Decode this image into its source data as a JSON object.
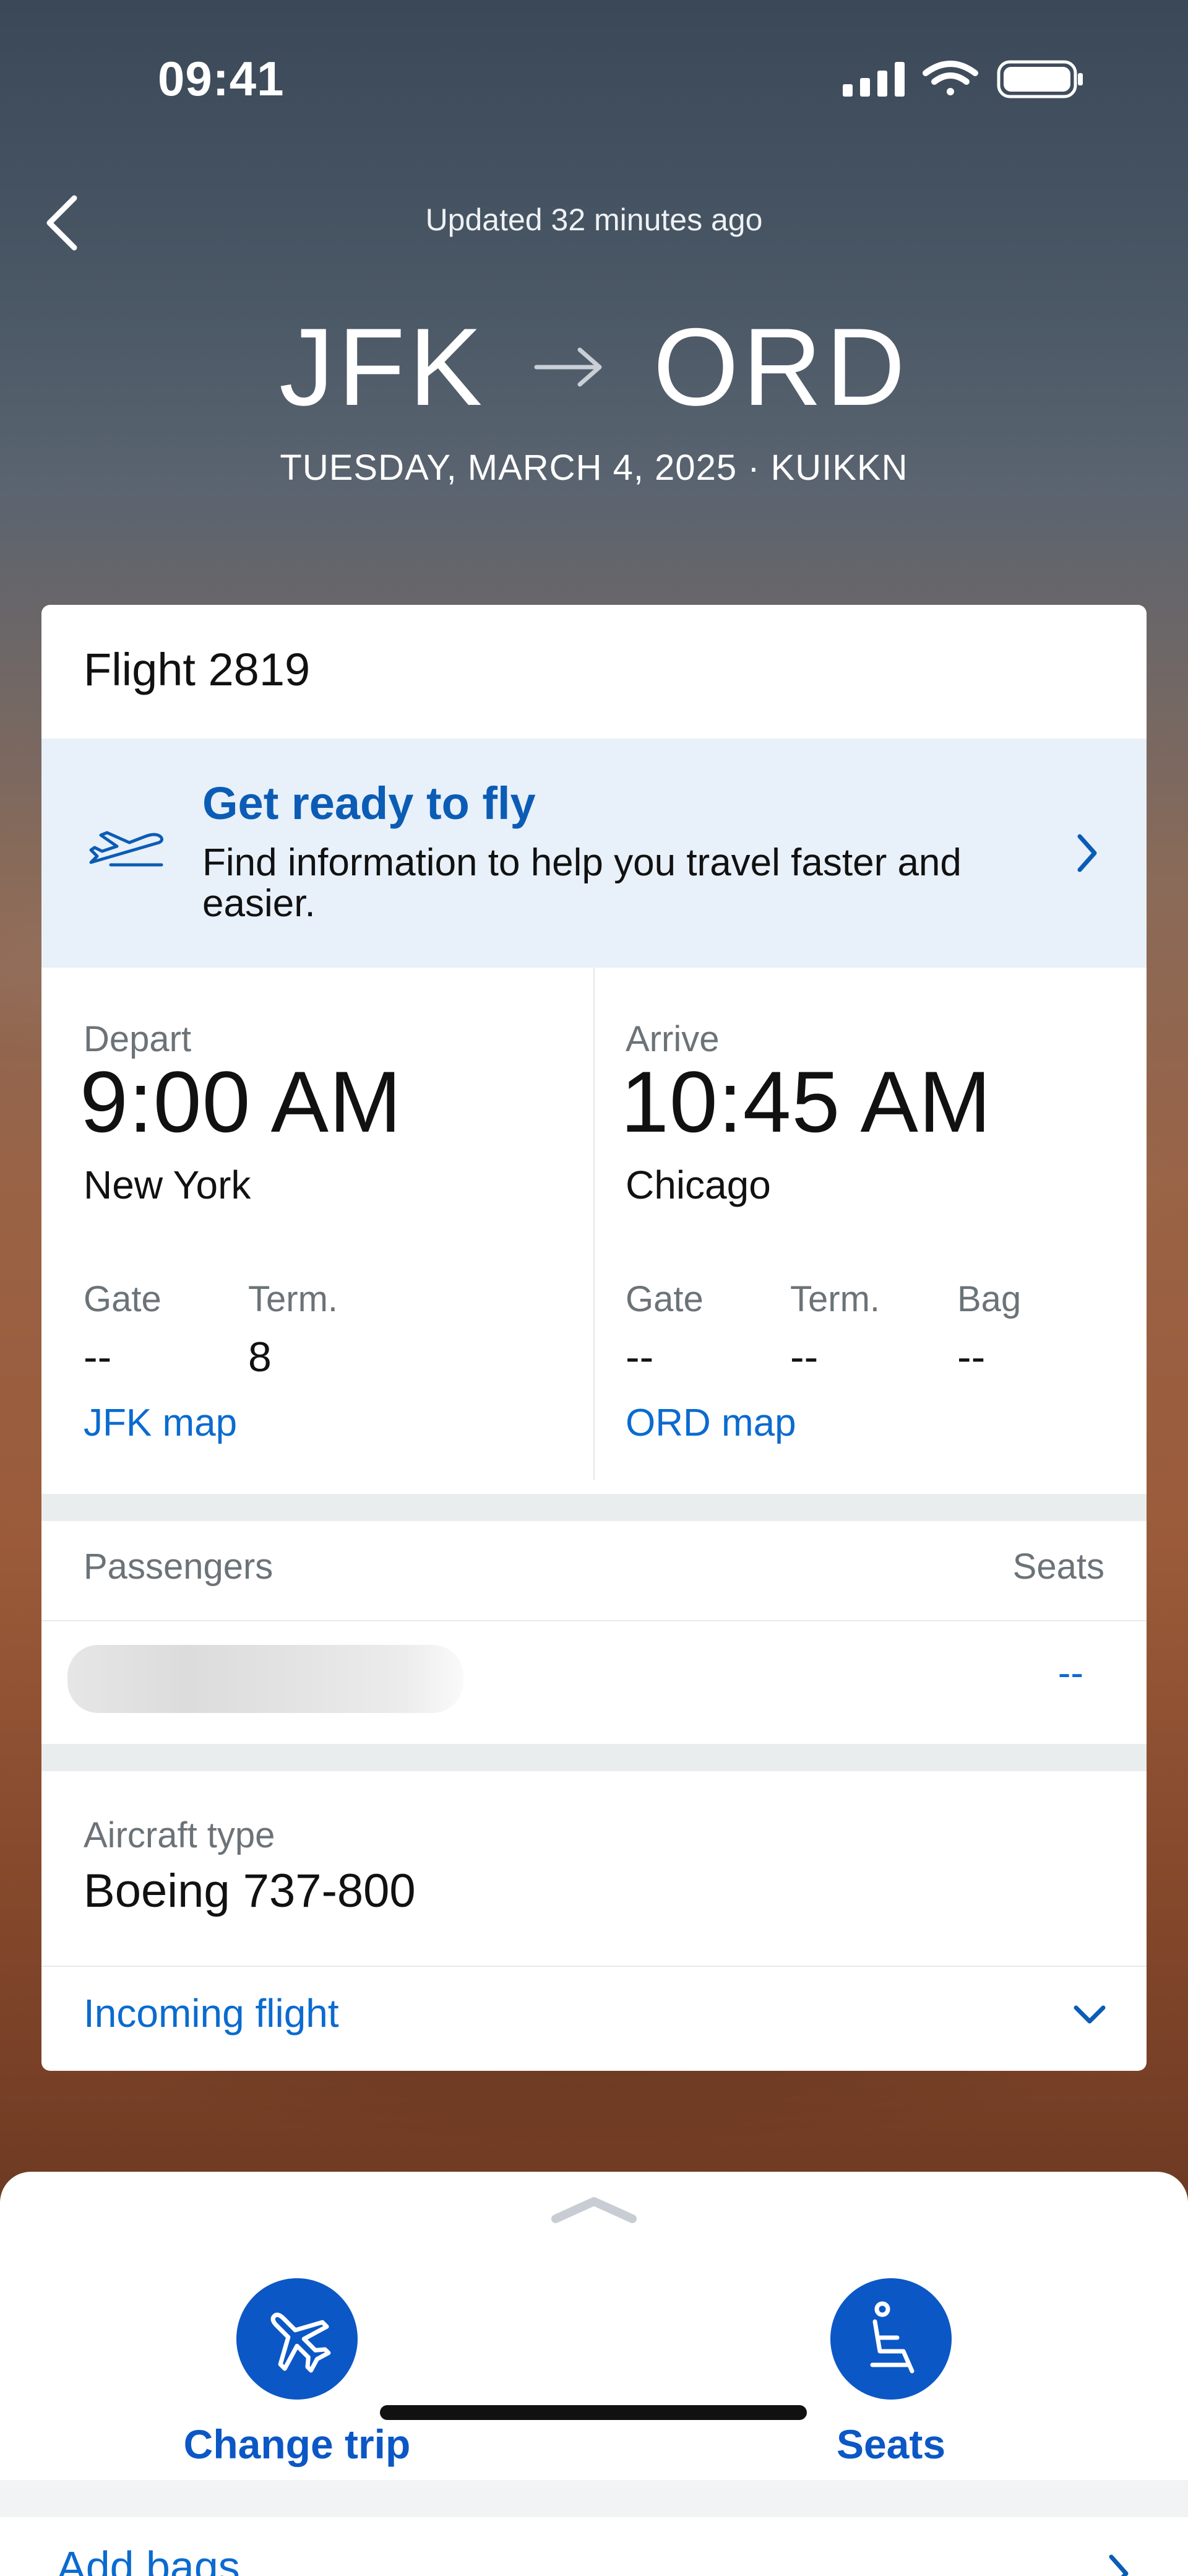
{
  "status_bar": {
    "time": "09:41"
  },
  "header": {
    "updated": "Updated 32 minutes ago",
    "origin": "JFK",
    "destination": "ORD",
    "date_line": "TUESDAY, MARCH 4, 2025 · KUIKKN"
  },
  "card": {
    "flight_number": "Flight 2819",
    "ready": {
      "title": "Get ready to fly",
      "text": "Find information to help you travel faster and easier."
    },
    "depart": {
      "label": "Depart",
      "time": "9:00 AM",
      "city": "New York",
      "gate_label": "Gate",
      "gate": "--",
      "term_label": "Term.",
      "term": "8",
      "map_link": "JFK map"
    },
    "arrive": {
      "label": "Arrive",
      "time": "10:45 AM",
      "city": "Chicago",
      "gate_label": "Gate",
      "gate": "--",
      "term_label": "Term.",
      "term": "--",
      "bag_label": "Bag",
      "bag": "--",
      "map_link": "ORD map"
    },
    "passengers": {
      "header": "Passengers",
      "seats_header": "Seats",
      "seat_value": "--"
    },
    "aircraft": {
      "label": "Aircraft type",
      "value": "Boeing 737-800"
    },
    "incoming": "Incoming flight"
  },
  "sheet": {
    "change_trip": "Change trip",
    "seats": "Seats",
    "add_bags": "Add bags"
  },
  "colors": {
    "accent": "#0b57c6",
    "link": "#0b6bcf",
    "ready_bg": "#e8f0f9"
  }
}
